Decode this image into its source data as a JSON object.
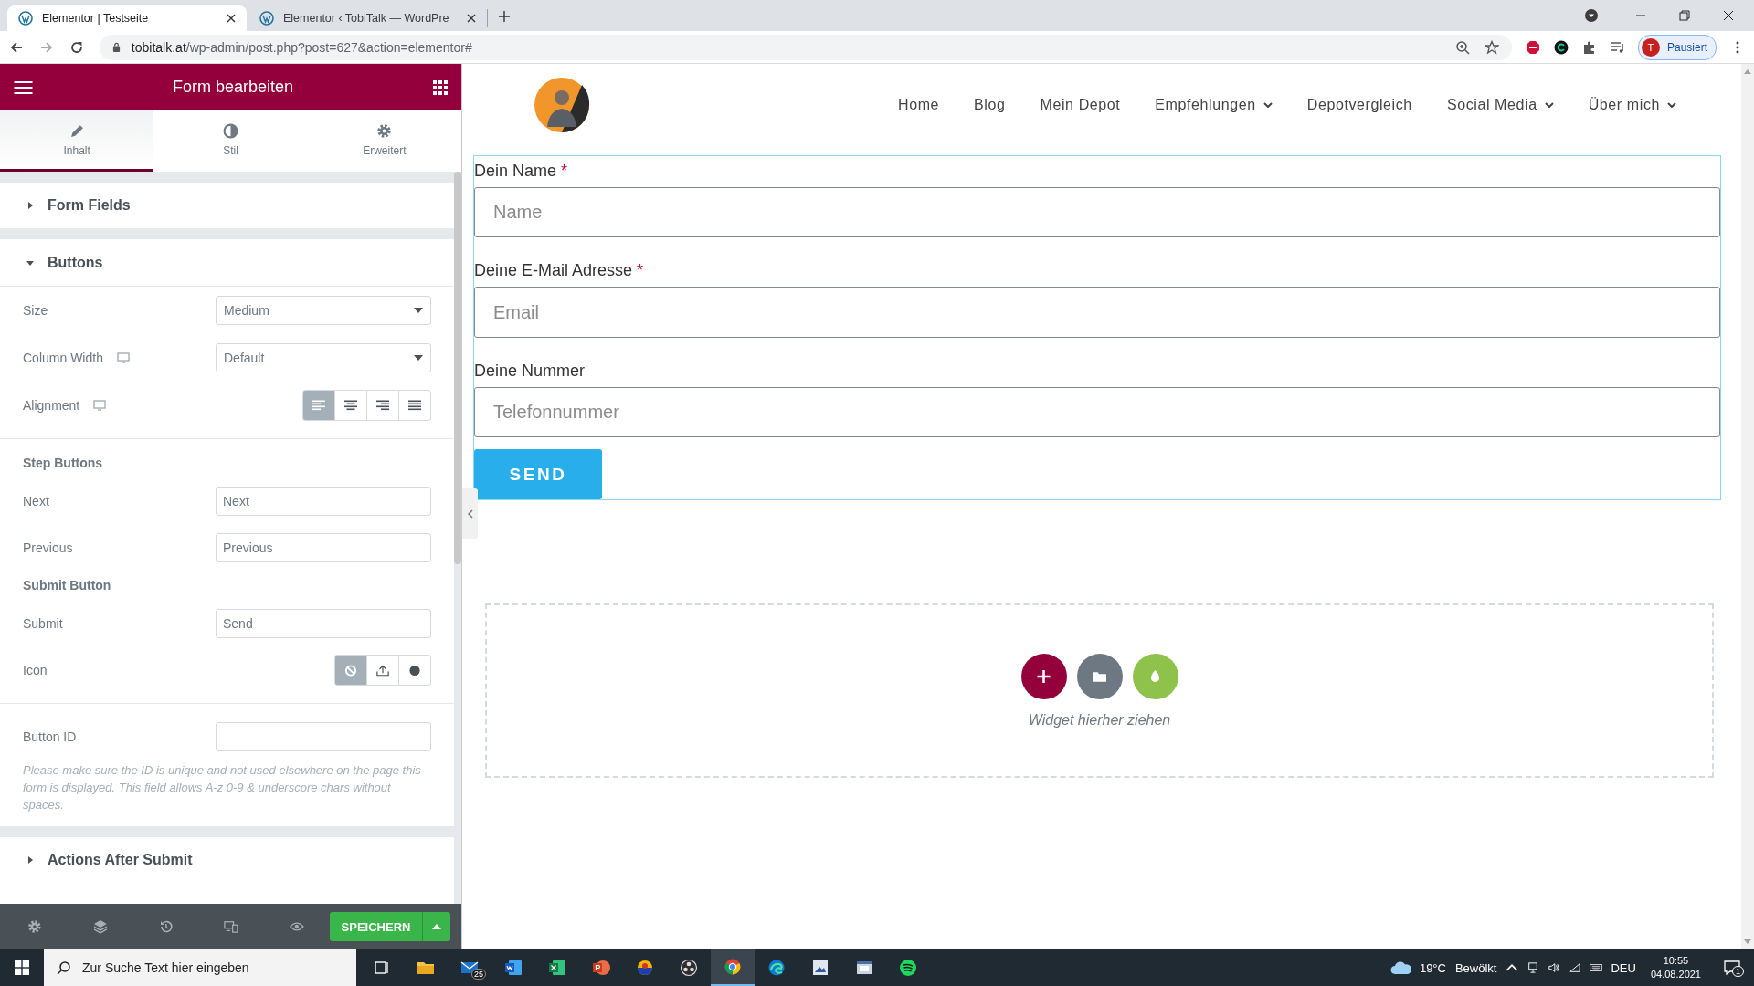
{
  "browser": {
    "tabs": [
      {
        "title": "Elementor | Testseite",
        "selected": true
      },
      {
        "title": "Elementor ‹ TobiTalk — WordPre",
        "selected": false
      }
    ],
    "url": {
      "host": "tobitalk.at",
      "path": "/wp-admin/post.php?post=627&action=elementor#"
    },
    "profile": {
      "initial": "T",
      "label": "Pausiert"
    }
  },
  "panel": {
    "title": "Form bearbeiten",
    "tabs": [
      {
        "label": "Inhalt",
        "selected": true
      },
      {
        "label": "Stil",
        "selected": false
      },
      {
        "label": "Erweitert",
        "selected": false
      }
    ],
    "items": [
      {
        "kind": "section",
        "title": "Form Fields",
        "expanded": false
      },
      {
        "kind": "section",
        "title": "Buttons",
        "expanded": true
      },
      {
        "kind": "select",
        "label": "Size",
        "value": "Medium",
        "responsive": false
      },
      {
        "kind": "select",
        "label": "Column Width",
        "value": "Default",
        "responsive": true
      },
      {
        "kind": "alignment-choice",
        "label": "Alignment",
        "responsive": true,
        "options": [
          {
            "selected": true
          },
          {
            "selected": false
          },
          {
            "selected": false
          },
          {
            "selected": false
          }
        ]
      },
      {
        "kind": "divider"
      },
      {
        "kind": "heading",
        "label": "Step Buttons"
      },
      {
        "kind": "text",
        "label": "Next",
        "value": "Next"
      },
      {
        "kind": "text",
        "label": "Previous",
        "value": "Previous"
      },
      {
        "kind": "heading",
        "label": "Submit Button"
      },
      {
        "kind": "text",
        "label": "Submit",
        "value": "Send"
      },
      {
        "kind": "icon-choice",
        "label": "Icon",
        "responsive": false,
        "options": [
          {
            "selected": true
          },
          {
            "selected": false
          },
          {
            "selected": false
          }
        ]
      },
      {
        "kind": "divider"
      },
      {
        "kind": "text",
        "label": "Button ID"
      },
      {
        "kind": "hint",
        "text": "Please make sure the ID is unique and not used elsewhere on the page this form is displayed. This field allows A-z  0-9 & underscore chars without spaces."
      },
      {
        "kind": "section",
        "title": "Actions After Submit",
        "expanded": false
      }
    ],
    "save": "SPEICHERN"
  },
  "page": {
    "nav": [
      {
        "label": "Home",
        "dropdown": false
      },
      {
        "label": "Blog",
        "dropdown": false
      },
      {
        "label": "Mein Depot",
        "dropdown": false
      },
      {
        "label": "Empfehlungen",
        "dropdown": true
      },
      {
        "label": "Depotvergleich",
        "dropdown": false
      },
      {
        "label": "Social Media",
        "dropdown": true
      },
      {
        "label": "Über mich",
        "dropdown": true
      }
    ],
    "form": {
      "fields": [
        {
          "label": "Dein Name",
          "mark": "*",
          "placeholder": "Name"
        },
        {
          "label": "Deine E-Mail Adresse",
          "mark": "*",
          "placeholder": "Email"
        },
        {
          "label": "Deine Nummer",
          "placeholder": "Telefonnummer"
        }
      ],
      "submit": "SEND"
    },
    "dropzone": "Widget hierher ziehen"
  },
  "taskbar": {
    "search": "Zur Suche Text hier eingeben",
    "mail_badge": "25",
    "temperature": "19°C",
    "weather": "Bewölkt",
    "language": "DEU",
    "time": "10:55",
    "date": "04.08.2021",
    "notifications": "1"
  }
}
